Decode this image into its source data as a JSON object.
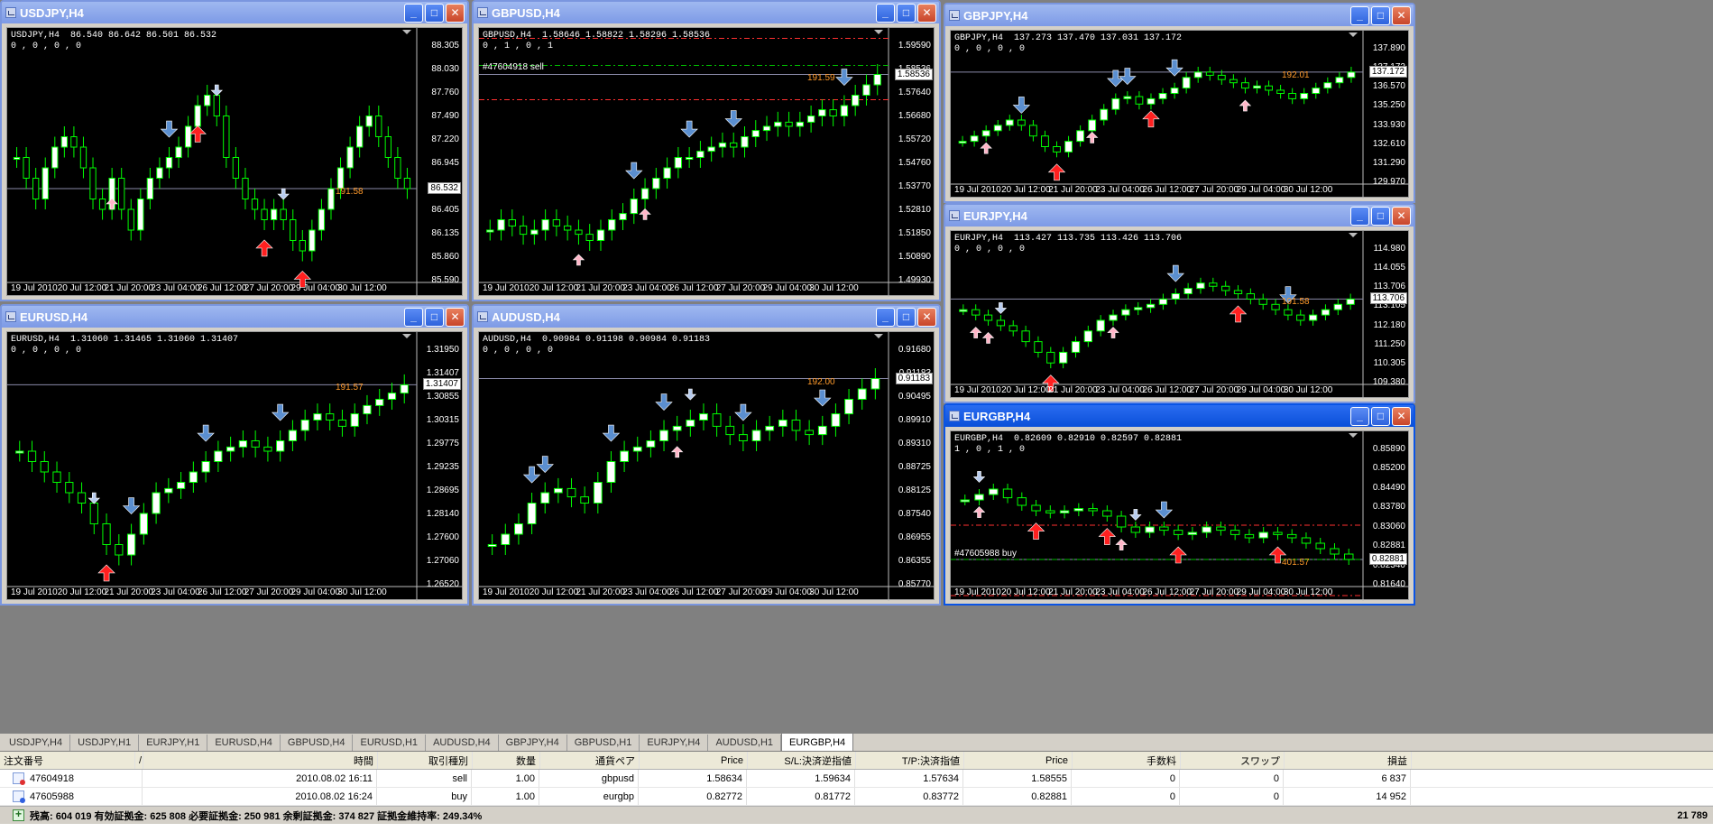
{
  "colors": {
    "bull": "#00ff00",
    "bullFill": "#ffffff",
    "bear": "#00ff00",
    "sellArrow": "#5b8fd0",
    "buyArrow": "#ff2020",
    "smallBuy": "#ffb6c8",
    "smallSell": "#b8ccee",
    "indicator": "#ff9a2a",
    "slLine": "#ff3030",
    "tpLine": "#00c000"
  },
  "dates": [
    "19 Jul 2010",
    "20 Jul 12:00",
    "21 Jul 20:00",
    "23 Jul 04:00",
    "26 Jul 12:00",
    "27 Jul 20:00",
    "29 Jul 04:00",
    "30 Jul 12:00"
  ],
  "windows": [
    {
      "id": "usdjpy",
      "title": "USDJPY,H4",
      "info": "USDJPY,H4  86.540 86.642 86.501 86.532\n0 , 0 , 0 , 0",
      "yaxis": [
        "88.305",
        "88.030",
        "87.760",
        "87.490",
        "87.220",
        "86.945",
        "86.675",
        "86.405",
        "86.135",
        "85.860",
        "85.590"
      ],
      "price": "86.532",
      "indicator": "191.58",
      "order": "",
      "active": false
    },
    {
      "id": "gbpusd",
      "title": "GBPUSD,H4",
      "info": "GBPUSD,H4  1.58646 1.58822 1.58296 1.58536\n0 , 1 , 0 , 1",
      "yaxis": [
        "1.59590",
        "1.58536",
        "1.57640",
        "1.56680",
        "1.55720",
        "1.54760",
        "1.53770",
        "1.52810",
        "1.51850",
        "1.50890",
        "1.49930"
      ],
      "price": "1.58536",
      "indicator": "191.59",
      "order": "#47604918 sell",
      "active": false
    },
    {
      "id": "gbpjpy",
      "title": "GBPJPY,H4",
      "info": "GBPJPY,H4  137.273 137.470 137.031 137.172\n0 , 0 , 0 , 0",
      "yaxis": [
        "137.890",
        "137.172",
        "136.570",
        "135.250",
        "133.930",
        "132.610",
        "131.290",
        "129.970"
      ],
      "price": "137.172",
      "indicator": "192.01",
      "order": "",
      "active": false
    },
    {
      "id": "eurusd",
      "title": "EURUSD,H4",
      "info": "EURUSD,H4  1.31060 1.31465 1.31060 1.31407\n0 , 0 , 0 , 0",
      "yaxis": [
        "1.31950",
        "1.31407",
        "1.30855",
        "1.30315",
        "1.29775",
        "1.29235",
        "1.28695",
        "1.28140",
        "1.27600",
        "1.27060",
        "1.26520"
      ],
      "price": "1.31407",
      "indicator": "191.57",
      "order": "",
      "active": false
    },
    {
      "id": "audusd",
      "title": "AUDUSD,H4",
      "info": "AUDUSD,H4  0.90984 0.91198 0.90984 0.91183\n0 , 0 , 0 , 0",
      "yaxis": [
        "0.91680",
        "0.91183",
        "0.90495",
        "0.89910",
        "0.89310",
        "0.88725",
        "0.88125",
        "0.87540",
        "0.86955",
        "0.86355",
        "0.85770"
      ],
      "price": "0.91183",
      "indicator": "192.00",
      "order": "",
      "active": false
    },
    {
      "id": "eurjpy",
      "title": "EURJPY,H4",
      "info": "EURJPY,H4  113.427 113.735 113.426 113.706\n0 , 0 , 0 , 0",
      "yaxis": [
        "114.980",
        "114.055",
        "113.706",
        "113.105",
        "112.180",
        "111.250",
        "110.305",
        "109.380"
      ],
      "price": "113.706",
      "indicator": "191.58",
      "order": "",
      "active": false
    },
    {
      "id": "eurgbp",
      "title": "EURGBP,H4",
      "info": "EURGBP,H4  0.82609 0.82910 0.82597 0.82881\n1 , 0 , 1 , 0",
      "yaxis": [
        "0.85890",
        "0.85200",
        "0.84490",
        "0.83780",
        "0.83060",
        "0.82881",
        "0.82340",
        "0.81640"
      ],
      "price": "0.82881",
      "indicator": "401.57",
      "order": "#47605988 buy",
      "active": true
    }
  ],
  "tabs": [
    "USDJPY,H4",
    "USDJPY,H1",
    "EURJPY,H1",
    "EURUSD,H4",
    "GBPUSD,H4",
    "EURUSD,H1",
    "AUDUSD,H4",
    "GBPJPY,H4",
    "GBPUSD,H1",
    "EURJPY,H4",
    "AUDUSD,H1",
    "EURGBP,H4"
  ],
  "active_tab": 11,
  "terminal": {
    "headers": [
      "注文番号",
      "/",
      "時間",
      "取引種別",
      "数量",
      "通貨ペア",
      "Price",
      "S/L:決済逆指値",
      "T/P:決済指値",
      "Price",
      "手数料",
      "スワップ",
      "損益"
    ],
    "rows": [
      {
        "type": "sell",
        "cells": [
          "47604918",
          "2010.08.02 16:11",
          "sell",
          "1.00",
          "gbpusd",
          "1.58634",
          "1.59634",
          "1.57634",
          "1.58555",
          "0",
          "0",
          "6 837"
        ]
      },
      {
        "type": "buy",
        "cells": [
          "47605988",
          "2010.08.02 16:24",
          "buy",
          "1.00",
          "eurgbp",
          "0.82772",
          "0.81772",
          "0.83772",
          "0.82881",
          "0",
          "0",
          "14 952"
        ]
      }
    ],
    "summary": "残高: 604 019  有効証拠金: 625 808  必要証拠金: 250 981  余剰証拠金: 374 827  証拠金維持率: 249.34%",
    "total": "21 789"
  }
}
